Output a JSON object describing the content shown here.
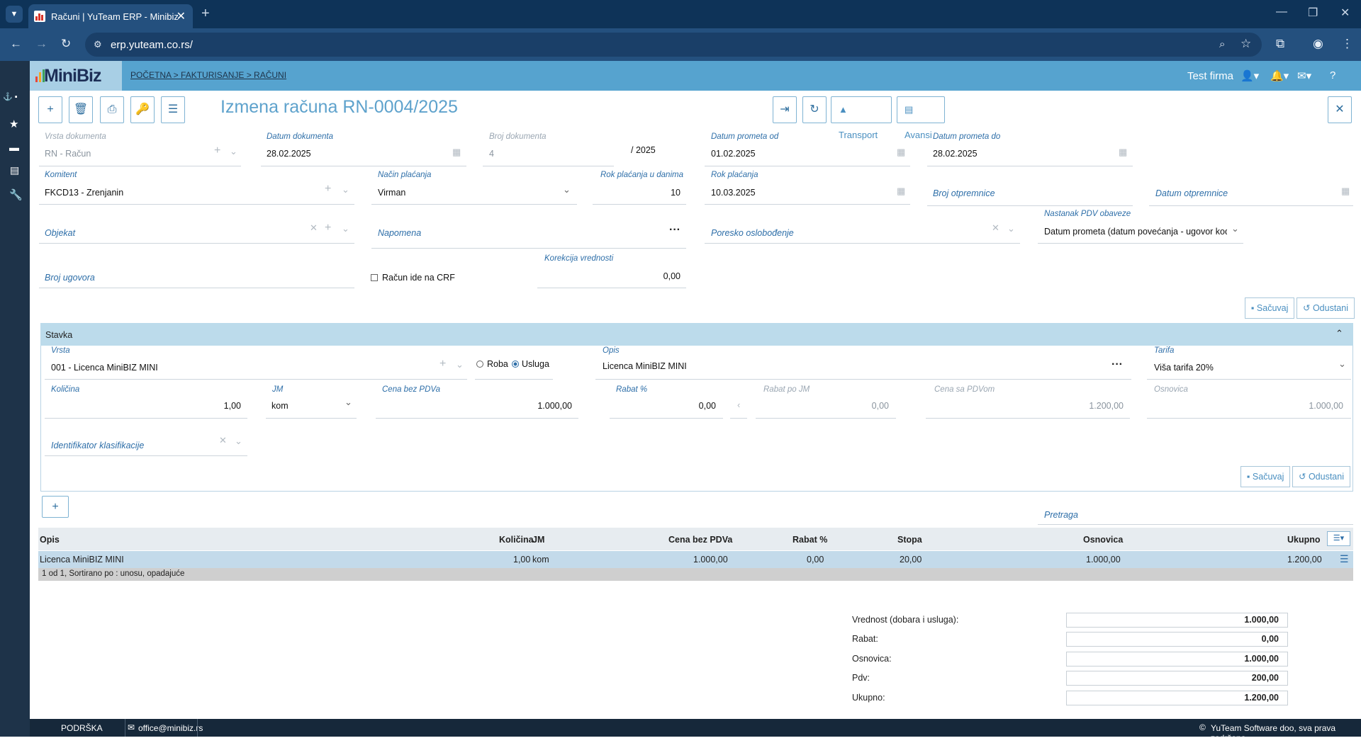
{
  "browser": {
    "tab_title": "Računi | YuTeam ERP - Minibiz",
    "url": "erp.yuteam.co.rs/"
  },
  "app": {
    "logo": "MiniBiz",
    "breadcrumb": "POČETNA > FAKTURISANJE > RAČUNI",
    "company": "Test firma"
  },
  "page": {
    "title": "Izmena računa RN-0004/2025",
    "transport_label": "Transport",
    "avansi_label": "Avansi"
  },
  "form": {
    "vrsta_dokumenta": {
      "label": "Vrsta dokumenta",
      "value": "RN - Račun"
    },
    "datum_dokumenta": {
      "label": "Datum dokumenta",
      "value": "28.02.2025"
    },
    "broj_dokumenta": {
      "label": "Broj dokumenta",
      "value": "4",
      "suffix": "/  2025"
    },
    "datum_prometa_od": {
      "label": "Datum prometa od",
      "value": "01.02.2025"
    },
    "datum_prometa_do": {
      "label": "Datum prometa do",
      "value": "28.02.2025"
    },
    "komitent": {
      "label": "Komitent",
      "value": "FKCD13 - Zrenjanin"
    },
    "nacin_placanja": {
      "label": "Način plaćanja",
      "value": "Virman"
    },
    "rok_dani": {
      "label": "Rok plaćanja u danima",
      "value": "10"
    },
    "rok_placanja": {
      "label": "Rok plaćanja",
      "value": "10.03.2025"
    },
    "broj_otpremnice": {
      "placeholder": "Broj otpremnice"
    },
    "datum_otpremnice": {
      "placeholder": "Datum otpremnice"
    },
    "objekat": {
      "placeholder": "Objekat"
    },
    "napomena": {
      "placeholder": "Napomena"
    },
    "poresko": {
      "placeholder": "Poresko oslobođenje"
    },
    "nastanak_pdv": {
      "label": "Nastanak PDV obaveze",
      "value": "Datum prometa (datum povećanja - ugovor kod kr"
    },
    "broj_ugovora": {
      "placeholder": "Broj ugovora"
    },
    "crf_label": "Račun ide na CRF",
    "korekcija": {
      "label": "Korekcija vrednosti",
      "value": "0,00"
    },
    "save_label": "Sačuvaj",
    "cancel_label": "Odustani"
  },
  "stavka": {
    "header": "Stavka",
    "vrsta": {
      "label": "Vrsta",
      "value": "001 - Licenca MiniBIZ MINI"
    },
    "roba_label": "Roba",
    "usluga_label": "Usluga",
    "opis": {
      "label": "Opis",
      "value": "Licenca MiniBIZ MINI"
    },
    "tarifa": {
      "label": "Tarifa",
      "value": "Viša tarifa 20%"
    },
    "kolicina": {
      "label": "Količina",
      "value": "1,00"
    },
    "jm": {
      "label": "JM",
      "value": "kom"
    },
    "cena_bez_pdv": {
      "label": "Cena bez PDVa",
      "value": "1.000,00"
    },
    "rabat": {
      "label": "Rabat %",
      "value": "0,00"
    },
    "rabat_po_jm": {
      "label": "Rabat po JM",
      "value": "0,00"
    },
    "cena_sa_pdv": {
      "label": "Cena sa PDVom",
      "value": "1.200,00"
    },
    "osnovica": {
      "label": "Osnovica",
      "value": "1.000,00"
    },
    "identifikator": {
      "placeholder": "Identifikator klasifikacije"
    },
    "save_label": "Sačuvaj",
    "cancel_label": "Odustani"
  },
  "pretraga": {
    "placeholder": "Pretraga"
  },
  "table": {
    "columns": [
      "Opis",
      "Količina",
      "JM",
      "Cena bez PDVa",
      "Rabat %",
      "Stopa",
      "Osnovica",
      "Ukupno"
    ],
    "rows": [
      {
        "opis": "Licenca MiniBIZ MINI",
        "kolicina": "1,00",
        "jm": "kom",
        "cena": "1.000,00",
        "rabat": "0,00",
        "stopa": "20,00",
        "osnovica": "1.000,00",
        "ukupno": "1.200,00"
      }
    ],
    "footer": "1 od 1, Sortirano po : unosu, opadajuće"
  },
  "totals": {
    "vrednost": {
      "label": "Vrednost (dobara i usluga):",
      "value": "1.000,00"
    },
    "rabat": {
      "label": "Rabat:",
      "value": "0,00"
    },
    "osnovica": {
      "label": "Osnovica:",
      "value": "1.000,00"
    },
    "pdv": {
      "label": "Pdv:",
      "value": "200,00"
    },
    "ukupno": {
      "label": "Ukupno:",
      "value": "1.200,00"
    }
  },
  "footer": {
    "podrska": "PODRŠKA",
    "email": "office@minibiz.rs",
    "copyright": "YuTeam Software doo, sva prava zadržana"
  },
  "colors": {
    "appbar": "#56a3cf",
    "sidebar": "#1e3349",
    "accent": "#2d6ea8",
    "browser": "#24507e"
  }
}
